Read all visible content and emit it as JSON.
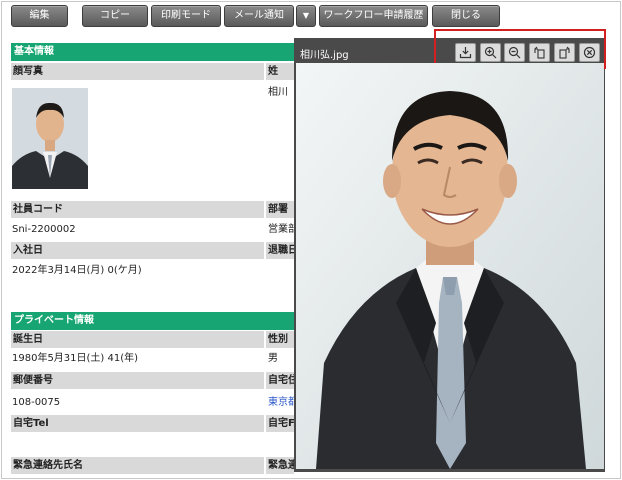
{
  "toolbar": {
    "edit": "編集",
    "copy": "コピー",
    "print_mode": "印刷モード",
    "mail_notify": "メール通知",
    "dropdown_arrow": "▼",
    "workflow_history": "ワークフロー申請履歴",
    "close": "閉じる"
  },
  "basic": {
    "section_title": "基本情報",
    "photo_label": "顔写真",
    "surname_label": "姓",
    "surname_value": "相川",
    "employee_code_label": "社員コード",
    "employee_code_value": "Sni-2200002",
    "department_label": "部署",
    "department_value": "営業部",
    "join_date_label": "入社日",
    "join_date_value": "2022年3月14日(月) 0(ケ月)",
    "retire_date_label": "退職日"
  },
  "private": {
    "section_title": "プライベート情報",
    "birthday_label": "誕生日",
    "birthday_value": "1980年5月31日(土) 41(年)",
    "gender_label": "性別",
    "gender_value": "男",
    "postal_label": "郵便番号",
    "postal_value": "108-0075",
    "home_address_label": "自宅住所",
    "home_address_value": "東京都",
    "home_tel_label": "自宅Tel",
    "home_fax_label": "自宅FAX",
    "emergency_name_label": "緊急連絡先氏名",
    "emergency_tel_label": "緊急連絡先"
  },
  "viewer": {
    "filename": "相川弘.jpg"
  },
  "icons": [
    "download-icon",
    "zoom-in-icon",
    "zoom-out-icon",
    "rotate-left-icon",
    "rotate-right-icon",
    "close-icon"
  ],
  "colors": {
    "section": "#17a673",
    "label_bg": "#d9d9d9",
    "button": "#6e6e6e",
    "highlight": "#d21f1f",
    "viewer_bg": "#4a4a4a"
  }
}
